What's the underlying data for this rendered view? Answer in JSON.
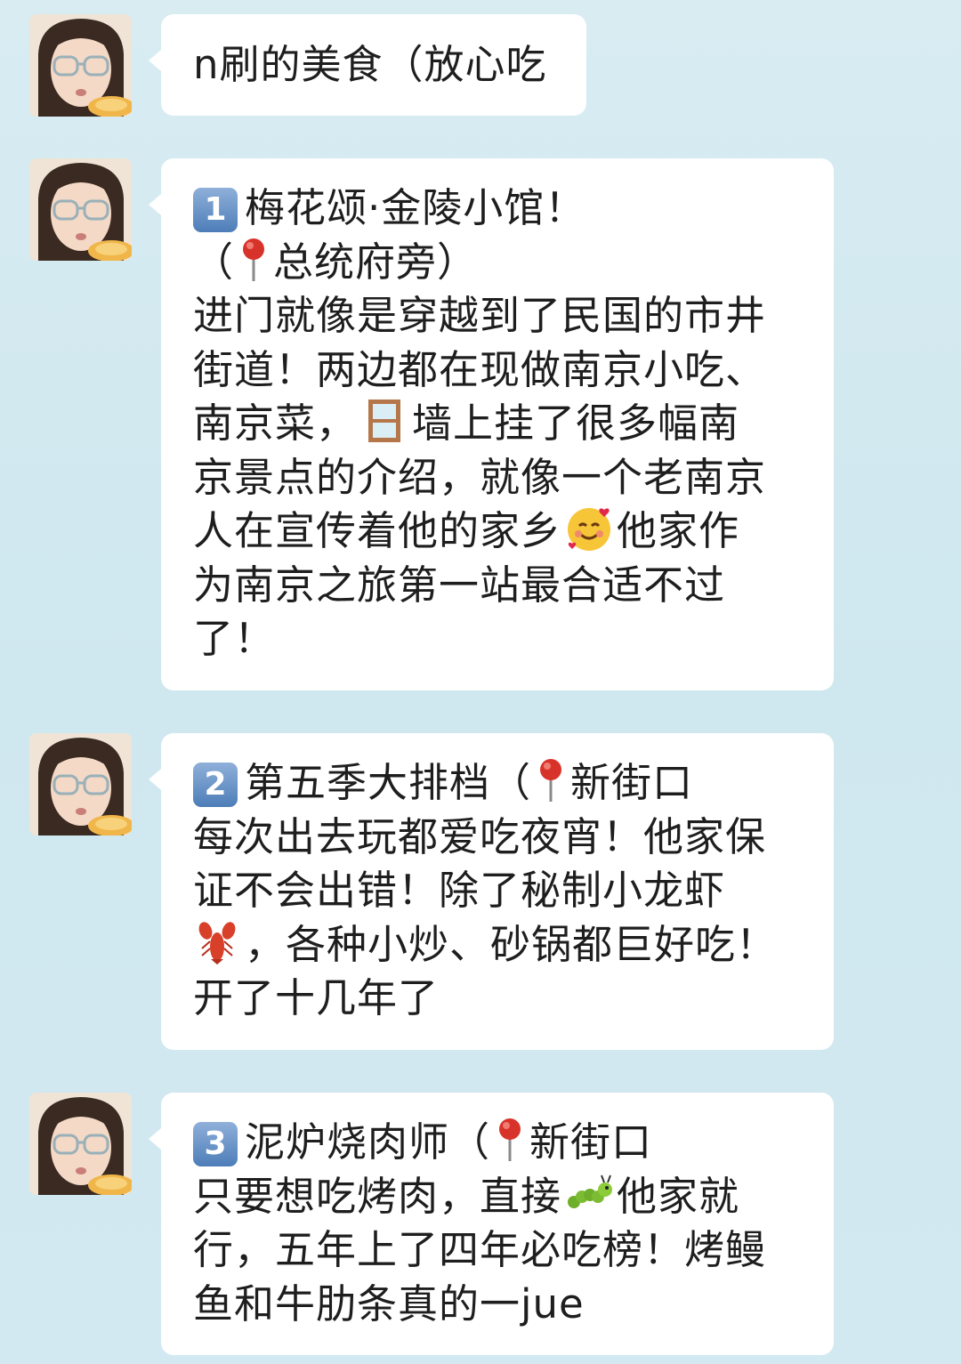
{
  "messages": [
    {
      "line1": "n刷的美食（放心吃"
    },
    {
      "number": "1",
      "lines": [
        "梅花颂·金陵小馆！",
        "（",
        "总统府旁）",
        "进门就像是穿越到了民国的市井",
        "街道！两边都在现做南京小吃、",
        "南京菜，",
        "墙上挂了很多幅南",
        "京景点的介绍，就像一个老南京",
        "人在宣传着他的家乡",
        "他家作",
        "为南京之旅第一站最合适不过",
        "了！"
      ],
      "icons": [
        "pin-icon",
        "window-icon",
        "smiling-hearts-icon"
      ]
    },
    {
      "number": "2",
      "lines": [
        "第五季大排档（",
        "新街口",
        "每次出去玩都爱吃夜宵！他家保",
        "证不会出错！除了秘制小龙虾",
        "，各种小炒、砂锅都巨好吃！",
        "开了十几年了"
      ],
      "icons": [
        "pin-icon",
        "lobster-icon"
      ]
    },
    {
      "number": "3",
      "lines": [
        "泥炉烧肉师（",
        "新街口",
        "只要想吃烤肉，直接",
        "他家就",
        "行，五年上了四年必吃榜！烤鳗",
        "鱼和牛肋条真的一jue"
      ],
      "icons": [
        "pin-icon",
        "caterpillar-icon"
      ]
    }
  ]
}
